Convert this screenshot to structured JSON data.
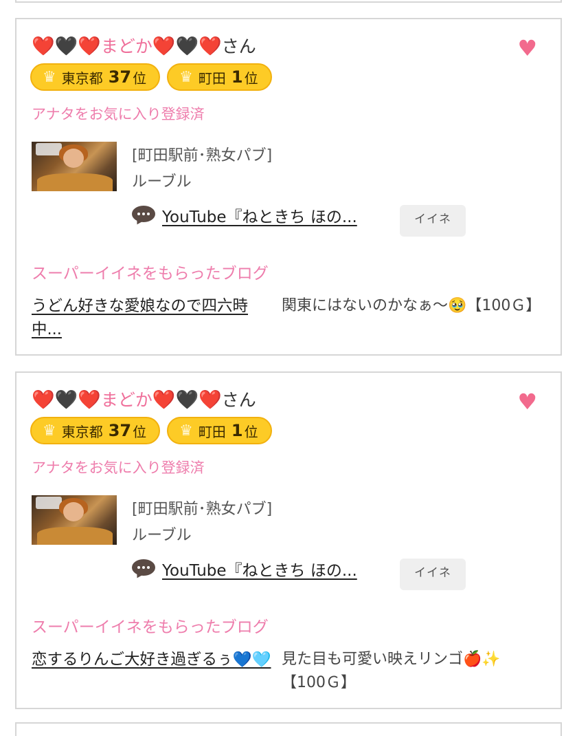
{
  "cards": [
    {
      "user": {
        "prefix_hearts": [
          "❤️",
          "🖤",
          "❤️"
        ],
        "name": "まどか",
        "suffix_hearts": [
          "❤️",
          "🖤",
          "❤️"
        ],
        "honorific": "さん"
      },
      "favorite_icon": "heart-icon",
      "badges": [
        {
          "icon": "crown-icon",
          "area": "東京都",
          "rank": "37",
          "unit": "位"
        },
        {
          "icon": "crown-icon",
          "area": "町田",
          "rank": "1",
          "unit": "位"
        }
      ],
      "fav_status": "アナタをお気に入り登録済",
      "shop": {
        "category": "[町田駅前･熟女パブ]",
        "name": "ルーブル"
      },
      "comment": {
        "icon": "speech-bubble-icon",
        "text": "YouTube『ねときち ほの..."
      },
      "iine_label": "イイネ",
      "super_title": "スーパーイイネをもらったブログ",
      "blog": {
        "title": "うどん好きな愛娘なので四六時中...",
        "comment": "関東にはないのかなぁ〜🥹【100Ｇ】"
      }
    },
    {
      "user": {
        "prefix_hearts": [
          "❤️",
          "🖤",
          "❤️"
        ],
        "name": "まどか",
        "suffix_hearts": [
          "❤️",
          "🖤",
          "❤️"
        ],
        "honorific": "さん"
      },
      "favorite_icon": "heart-icon",
      "badges": [
        {
          "icon": "crown-icon",
          "area": "東京都",
          "rank": "37",
          "unit": "位"
        },
        {
          "icon": "crown-icon",
          "area": "町田",
          "rank": "1",
          "unit": "位"
        }
      ],
      "fav_status": "アナタをお気に入り登録済",
      "shop": {
        "category": "[町田駅前･熟女パブ]",
        "name": "ルーブル"
      },
      "comment": {
        "icon": "speech-bubble-icon",
        "text": "YouTube『ねときち ほの..."
      },
      "iine_label": "イイネ",
      "super_title": "スーパーイイネをもらったブログ",
      "blog": {
        "title": "恋するりんご大好き過ぎるぅ💙🩵",
        "comment": "見た目も可愛い映えリンゴ🍎✨【100Ｇ】"
      }
    }
  ],
  "colors": {
    "accent_pink": "#ee7dac",
    "badge_yellow": "#fdcb26",
    "heart": "#f26a8d"
  }
}
